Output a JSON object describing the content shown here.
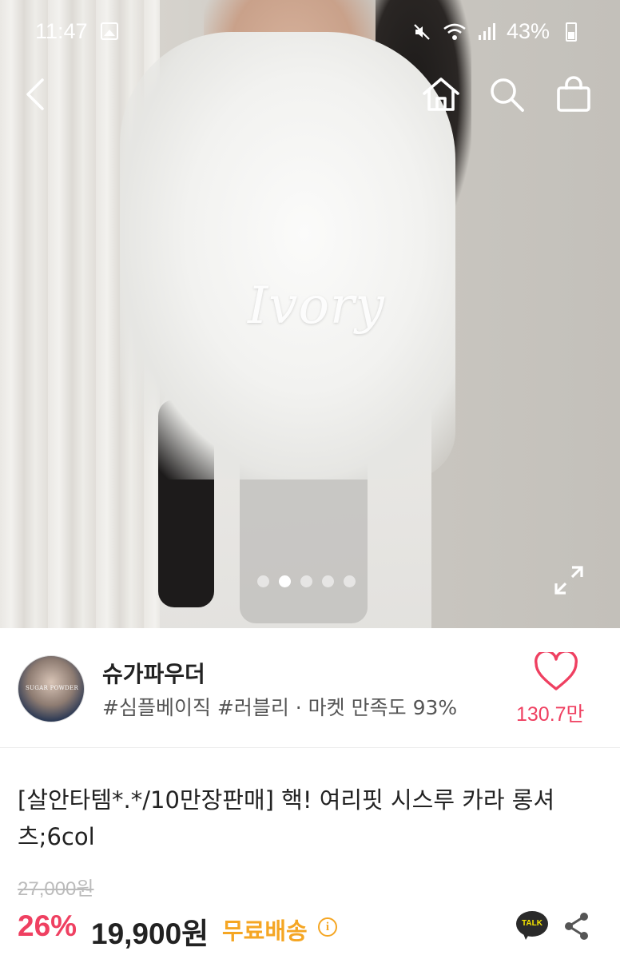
{
  "status_bar": {
    "time": "11:47",
    "battery": "43%",
    "icons": [
      "gallery-icon",
      "mute-icon",
      "wifi-icon",
      "signal-icon",
      "battery-icon"
    ]
  },
  "nav": {
    "icons": [
      "back-icon",
      "home-icon",
      "search-icon",
      "shopping-bag-icon"
    ]
  },
  "gallery": {
    "image_label": "Ivory",
    "dot_count": 5,
    "active_index": 1
  },
  "seller": {
    "avatar_text": "SUGAR POWDER",
    "name": "슈가파우더",
    "tags": "#심플베이직 #러블리 · 마켓 만족도 93%",
    "like_count": "130.7만"
  },
  "product": {
    "title": "[살안타템*.*/10만장판매] 핵! 여리핏 시스루 카라 롱셔츠;6col",
    "original_price": "27,000원",
    "discount": "26%",
    "price": "19,900원",
    "shipping": "무료배송",
    "info_symbol": "i",
    "talk_label": "TALK"
  },
  "colors": {
    "accent": "#ef4061",
    "shipping": "#f5a623"
  }
}
